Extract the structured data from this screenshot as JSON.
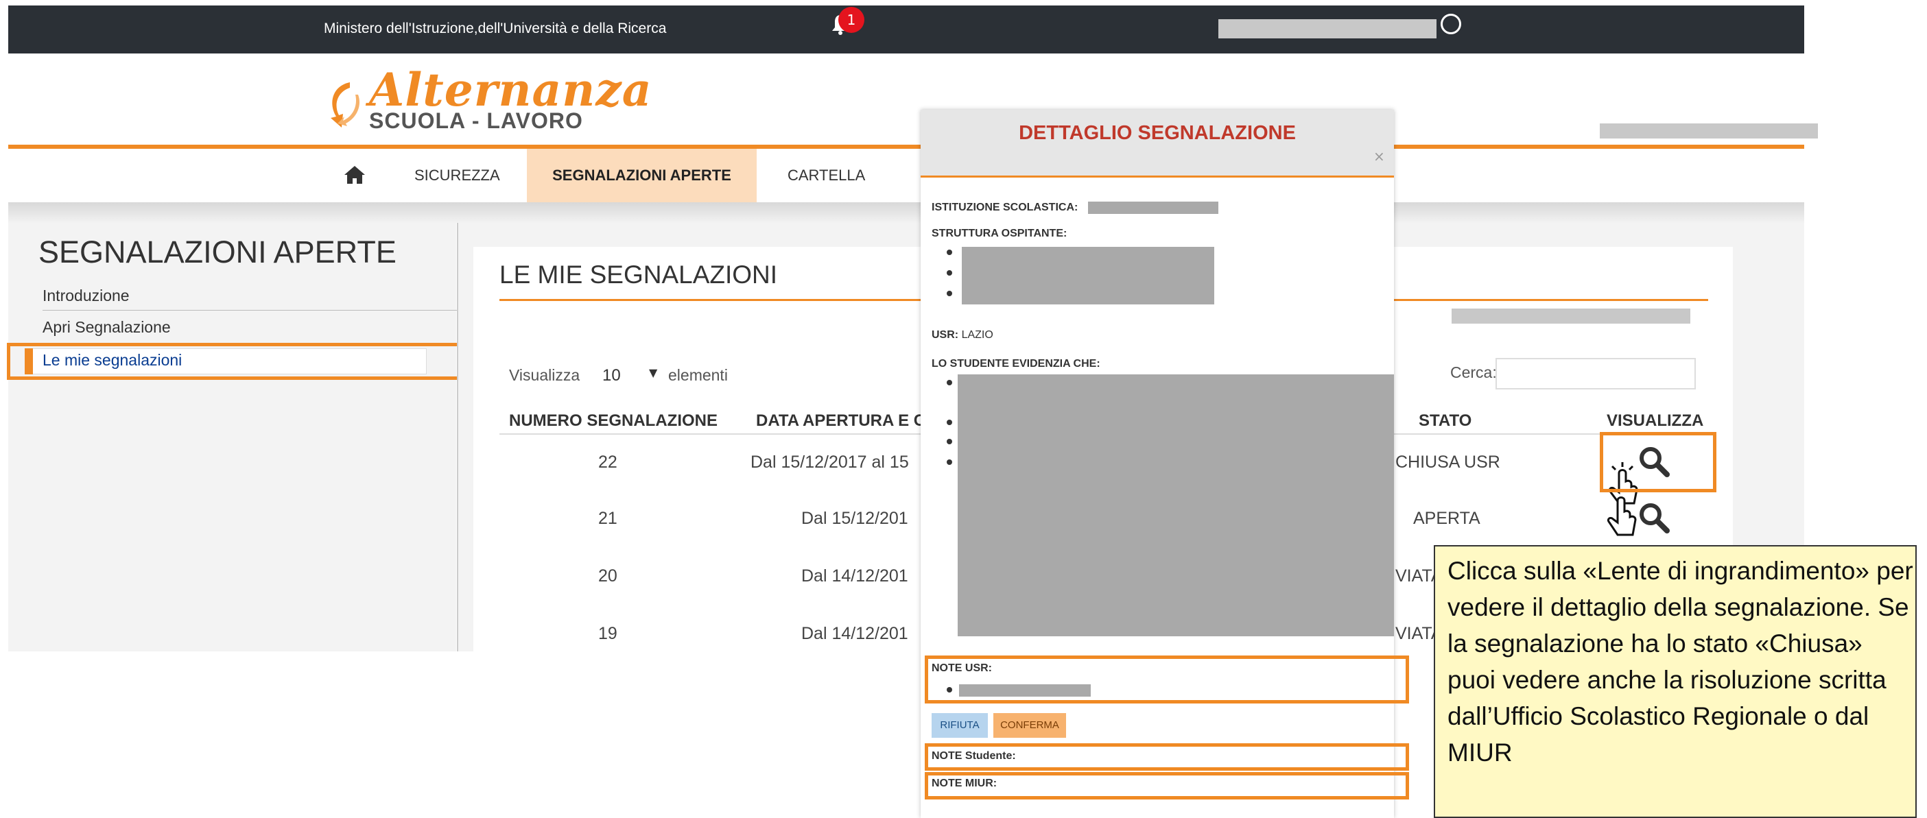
{
  "topbar": {
    "ministry": "Ministero dell'Istruzione,dell'Università e della Ricerca",
    "notifications_count": "1"
  },
  "logo": {
    "title": "Alternanza",
    "subtitle": "SCUOLA - LAVORO"
  },
  "nav": {
    "home_icon": "home-icon",
    "items": [
      "SICUREZZA",
      "SEGNALAZIONI APERTE",
      "CARTELLA"
    ],
    "active_index": 1
  },
  "sidebar": {
    "title": "SEGNALAZIONI APERTE",
    "items": [
      "Introduzione",
      "Apri Segnalazione",
      "Le mie segnalazioni"
    ],
    "active_index": 2
  },
  "main": {
    "title": "LE MIE SEGNALAZIONI",
    "visualizza_label": "Visualizza",
    "page_size": "10",
    "elementi_label": "elementi",
    "cerca_label": "Cerca:",
    "columns": [
      "NUMERO SEGNALAZIONE",
      "DATA APERTURA E CI",
      "STATO",
      "VISUALIZZA"
    ],
    "rows": [
      {
        "numero": "22",
        "data": "Dal 15/12/2017 al 15",
        "stato": "CHIUSA USR"
      },
      {
        "numero": "21",
        "data": "Dal 15/12/201",
        "stato": "APERTA"
      },
      {
        "numero": "20",
        "data": "Dal 14/12/201",
        "stato": "VIATA"
      },
      {
        "numero": "19",
        "data": "Dal 14/12/201",
        "stato": "VIATA"
      }
    ]
  },
  "modal": {
    "title": "DETTAGLIO SEGNALAZIONE",
    "close": "×",
    "istituzione_label": "ISTITUZIONE SCOLASTICA:",
    "struttura_label": "STRUTTURA OSPITANTE:",
    "usr_label": "USR:",
    "usr_value": "LAZIO",
    "studente_label": "LO STUDENTE EVIDENZIA CHE:",
    "note_usr_label": "NOTE USR:",
    "rifiuta": "RIFIUTA",
    "conferma": "CONFERMA",
    "note_studente_label": "NOTE Studente:",
    "note_miur_label": "NOTE MIUR:"
  },
  "tooltip": {
    "text": "Clicca sulla «Lente di ingrandimento» per vedere il dettaglio della segnalazione. Se la segnalazione ha lo stato «Chiusa» puoi vedere anche la risoluzione scritta dall’Ufficio Scolastico Regionale o dal MIUR"
  },
  "colors": {
    "accent": "#f08a24",
    "topbar": "#2b3036",
    "modal_title": "#c0392b",
    "tooltip_bg": "#fff9c4"
  }
}
